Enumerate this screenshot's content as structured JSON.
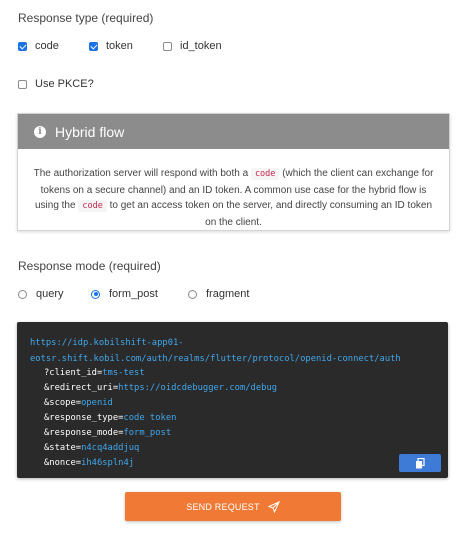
{
  "response_type": {
    "label": "Response type (required)",
    "options": [
      {
        "label": "code",
        "checked": true
      },
      {
        "label": "token",
        "checked": true
      },
      {
        "label": "id_token",
        "checked": false
      }
    ]
  },
  "pkce": {
    "label": "Use PKCE?",
    "checked": false
  },
  "hybrid_card": {
    "title": "Hybrid flow",
    "info_icon_glyph": "i",
    "text_1": "The authorization server will respond with both a",
    "code_1": "code",
    "text_2": "(which the client can exchange for tokens on a secure channel) and an ID token. A common use case for the hybrid flow is using the",
    "code_2": "code",
    "text_3": "to get an access token on the server, and directly consuming an ID token on the client."
  },
  "response_mode": {
    "label": "Response mode (required)",
    "options": [
      {
        "label": "query",
        "selected": false
      },
      {
        "label": "form_post",
        "selected": true
      },
      {
        "label": "fragment",
        "selected": false
      }
    ]
  },
  "request_url": {
    "line1": "https://idp.kobilshift-app01-",
    "line2": "eotsr.shift.kobil.com/auth/realms/flutter/protocol/openid-connect/auth",
    "params": [
      {
        "key": "?client_id=",
        "value": "tms-test"
      },
      {
        "key": "&redirect_uri=",
        "value": "https://oidcdebugger.com/debug"
      },
      {
        "key": "&scope=",
        "value": "openid"
      },
      {
        "key": "&response_type=",
        "value": "code token"
      },
      {
        "key": "&response_mode=",
        "value": "form_post"
      },
      {
        "key": "&state=",
        "value": "n4cq4addjuq"
      },
      {
        "key": "&nonce=",
        "value": "ih46spln4j"
      }
    ]
  },
  "buttons": {
    "send_label": "SEND REQUEST"
  },
  "colors": {
    "accent": "#1a73e8",
    "send_button": "#f07a35",
    "copy_button": "#3d7bd6",
    "card_header": "#8c8c8c",
    "code_bg": "#2a2a2a",
    "url_blue": "#41a7ec"
  }
}
